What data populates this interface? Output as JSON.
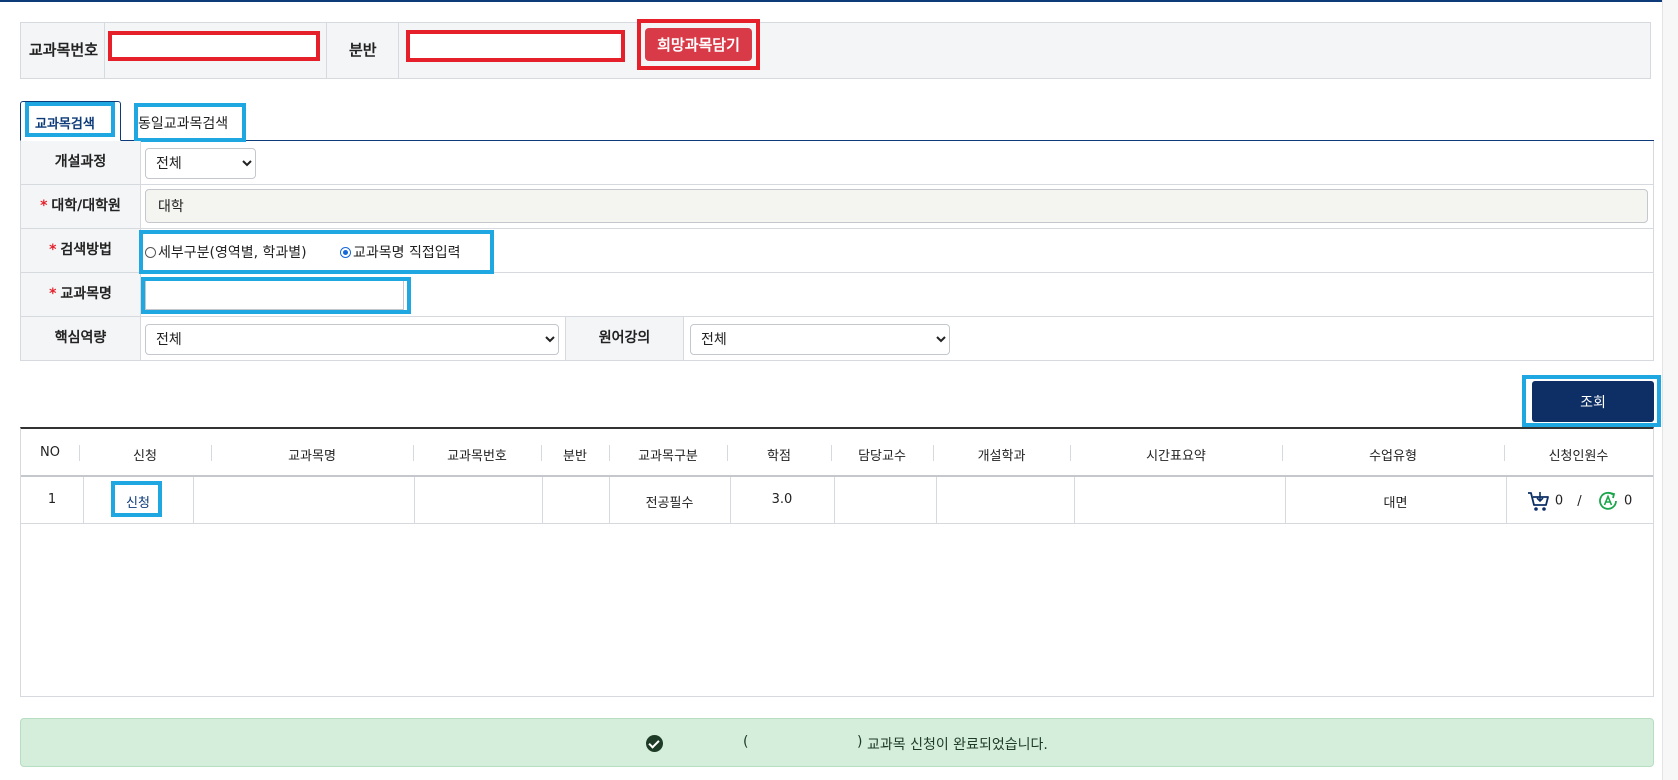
{
  "quick_apply": {
    "course_no_label": "교과목번호",
    "course_no_value": "",
    "section_label": "분반",
    "section_value": "",
    "add_button_label": "희망과목담기"
  },
  "tabs": [
    {
      "label": "교과목검색",
      "active": true
    },
    {
      "label": "동일교과목검색",
      "active": false
    }
  ],
  "search_form": {
    "program": {
      "label": "개설과정",
      "selected": "전체"
    },
    "level": {
      "label": "대학/대학원",
      "required": "*",
      "value": "대학"
    },
    "method": {
      "label": "검색방법",
      "required": "*",
      "options": [
        {
          "label": "세부구분(영역별, 학과별)",
          "checked": false
        },
        {
          "label": "교과목명 직접입력",
          "checked": true
        }
      ]
    },
    "course_name": {
      "label": "교과목명",
      "required": "*",
      "value": ""
    },
    "core_competency": {
      "label": "핵심역량",
      "selected": "전체"
    },
    "english_lecture": {
      "label": "원어강의",
      "selected": "전체"
    }
  },
  "query_button_label": "조회",
  "results": {
    "headers": [
      "NO",
      "신청",
      "교과목명",
      "교과목번호",
      "분반",
      "교과목구분",
      "학점",
      "담당교수",
      "개설학과",
      "시간표요약",
      "수업유형",
      "신청인원수"
    ],
    "rows": [
      {
        "no": "1",
        "apply": "신청",
        "name": "",
        "course_no": "",
        "section": "",
        "category": "전공필수",
        "credits": "3.0",
        "professor": "",
        "department": "",
        "schedule": "",
        "class_type": "대면",
        "cart_count": "0",
        "separator": "/",
        "applied_count": "0"
      }
    ]
  },
  "alert": {
    "open_paren": "(",
    "close_paren": ")",
    "message": "교과목 신청이 완료되었습니다."
  },
  "colors": {
    "navy": "#0d2f66",
    "highlight_red": "#e5202a",
    "highlight_blue": "#1ea7e1",
    "add_button": "#d93a48",
    "alert_bg": "#d5eddb"
  }
}
